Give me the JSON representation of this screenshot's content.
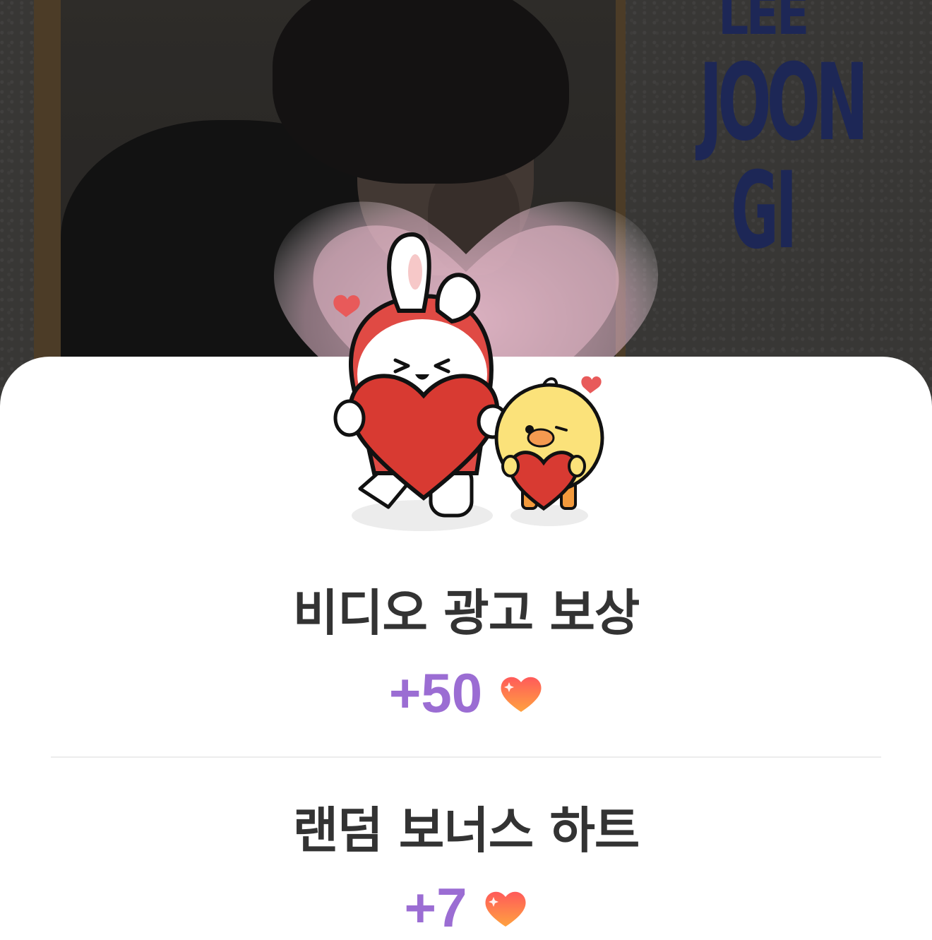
{
  "background": {
    "poster_text": [
      "LEE",
      "JOON",
      "GI"
    ]
  },
  "colors": {
    "amount": "#9b6dd3",
    "title": "#333333",
    "heart": "#ff6a4a"
  },
  "rewards": [
    {
      "title": "비디오 광고 보상",
      "amount": "+50",
      "icon": "heart-icon"
    },
    {
      "title": "랜덤 보너스 하트",
      "amount": "+7",
      "icon": "heart-icon"
    }
  ]
}
